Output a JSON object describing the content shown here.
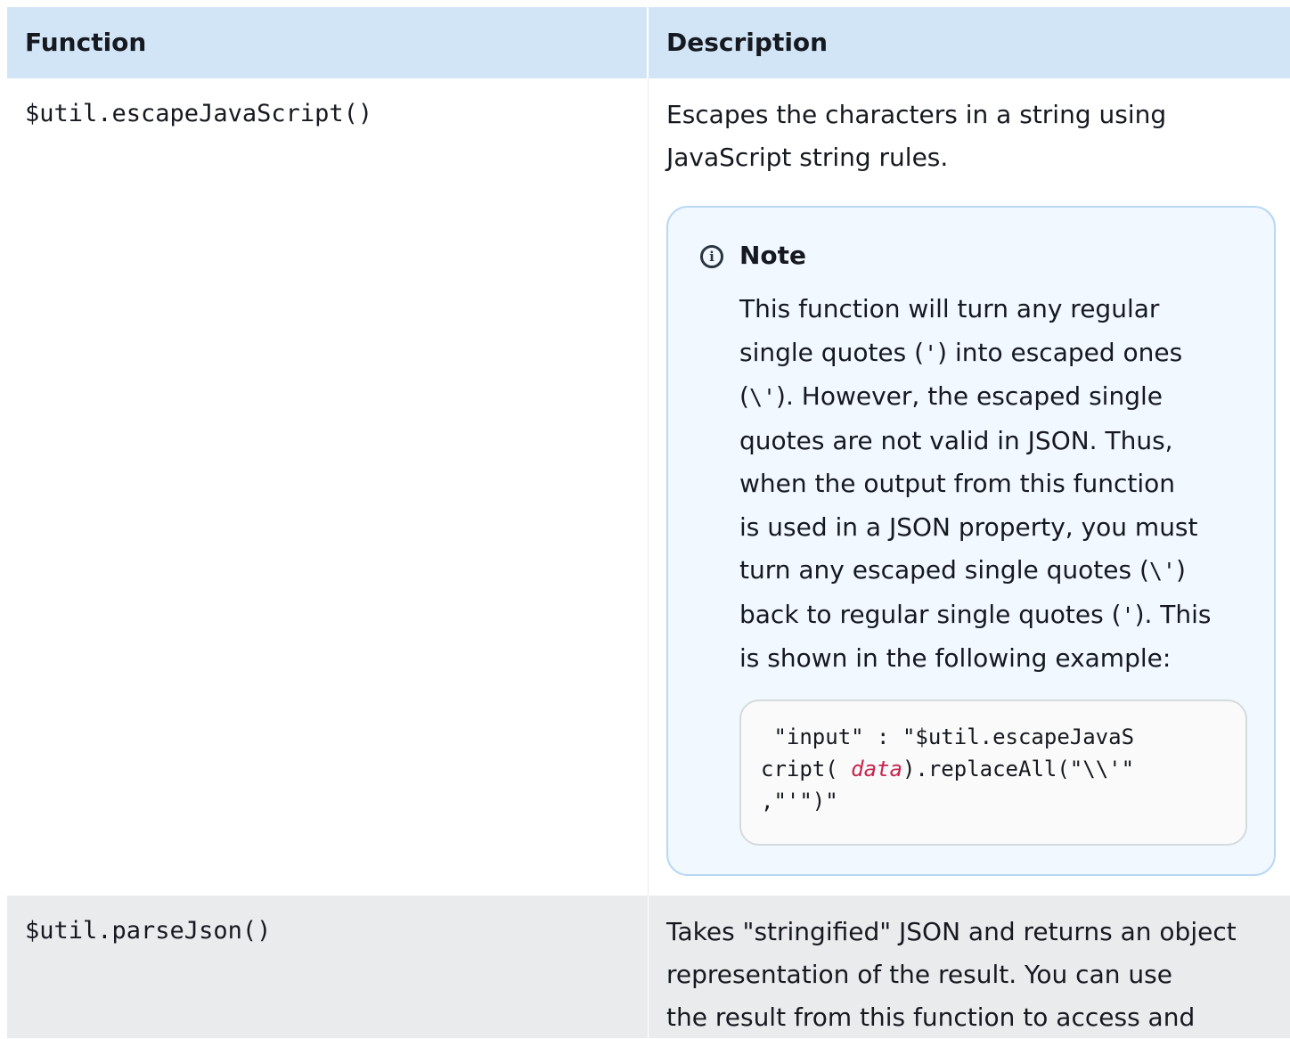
{
  "table": {
    "headers": {
      "function": "Function",
      "description": "Description"
    },
    "rows": [
      {
        "function": "$util.escapeJavaScript()",
        "description_lines": [
          "Escapes the characters in a string using",
          "JavaScript string rules."
        ],
        "note": {
          "icon": "info-icon",
          "title": "Note",
          "body_lines": [
            [
              "This function will turn any regular"
            ],
            [
              "single quotes (",
              "'",
              ") into escaped ones"
            ],
            [
              "(",
              "\\'",
              "). However, the escaped single"
            ],
            [
              "quotes are not valid in JSON. Thus,"
            ],
            [
              "when the output from this function"
            ],
            [
              "is used in a JSON property, you must"
            ],
            [
              "turn any escaped single quotes (",
              "\\'",
              ")"
            ],
            [
              "back to regular single quotes (",
              "'",
              "). This"
            ],
            [
              "is shown in the following example:"
            ]
          ],
          "code": {
            "line1": " \"input\" : \"$util.escapeJavaS",
            "line2_prefix": "cript( ",
            "line2_var": "data",
            "line2_suffix": ").replaceAll(\"\\\\'\"",
            "line3": ",\"'\")\""
          }
        }
      },
      {
        "function": "$util.parseJson()",
        "description_lines": [
          "Takes \"stringified\" JSON and returns an object",
          "representation of the result. You can use",
          "the result from this function to access and"
        ]
      }
    ]
  }
}
